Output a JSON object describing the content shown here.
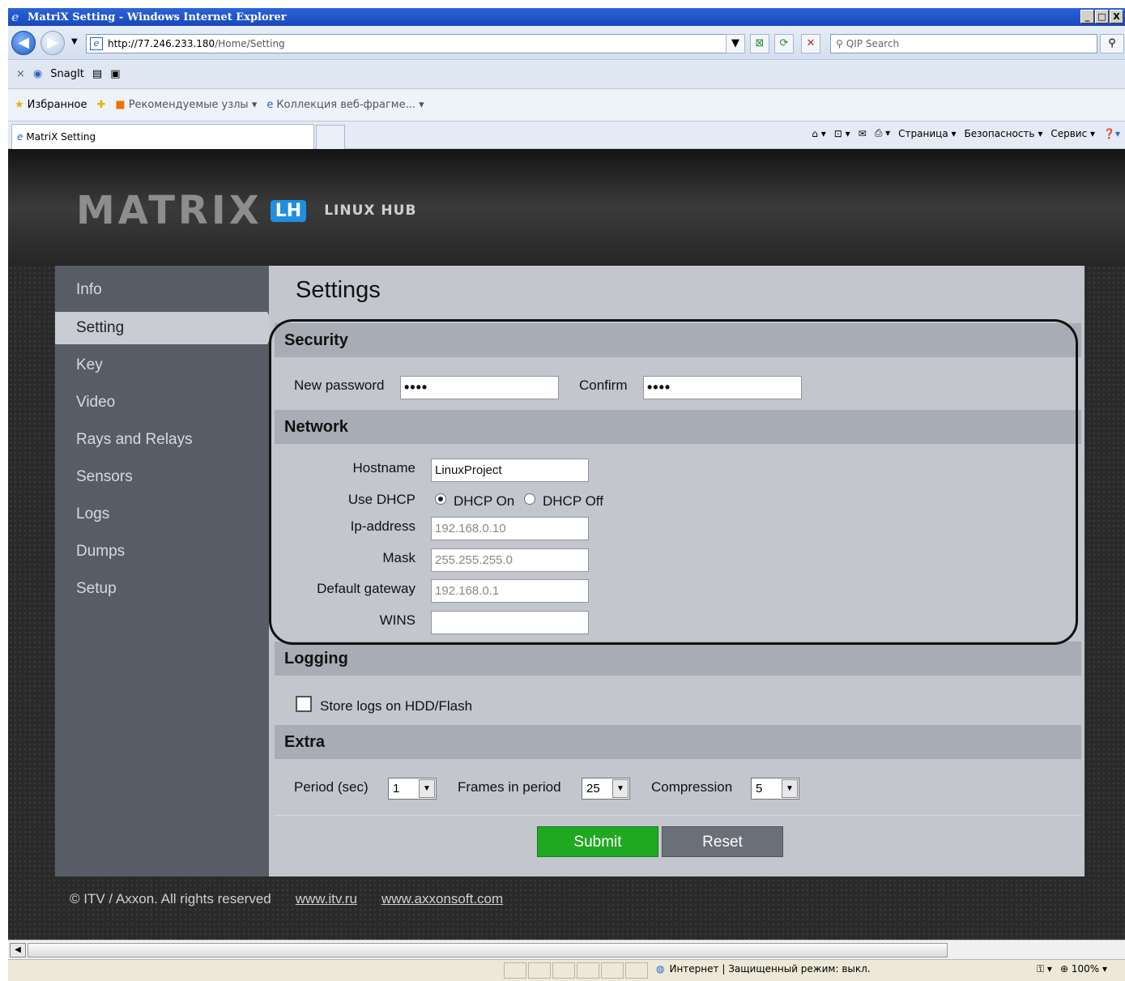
{
  "window": {
    "title": "MatriX Setting - Windows Internet Explorer",
    "minimize": "_",
    "maximize": "□",
    "close": "X"
  },
  "address_bar": {
    "url_host": "http://77.246.233.180",
    "url_path": "/Home/Setting",
    "search_placeholder": "QIP Search"
  },
  "toolbar": {
    "snagit_label": "SnagIt"
  },
  "favorites_bar": {
    "favorites_label": "Избранное",
    "suggested_sites": "Рекомендуемые узлы ▾",
    "web_slice_gallery": "Коллекция веб-фрагме... ▾"
  },
  "tab": {
    "title": "MatriX Setting"
  },
  "command_bar": {
    "page_menu": "Страница ▾",
    "safety_menu": "Безопасность ▾",
    "tools_menu": "Сервис ▾"
  },
  "brand": {
    "logo_text": "MATRIX",
    "logo_badge": "LH",
    "logo_subtitle": "LINUX HUB"
  },
  "sidebar": {
    "items": [
      {
        "label": "Info"
      },
      {
        "label": "Setting"
      },
      {
        "label": "Key"
      },
      {
        "label": "Video"
      },
      {
        "label": "Rays and Relays"
      },
      {
        "label": "Sensors"
      },
      {
        "label": "Logs"
      },
      {
        "label": "Dumps"
      },
      {
        "label": "Setup"
      }
    ],
    "active": "Setting"
  },
  "settings": {
    "title": "Settings",
    "security": {
      "header": "Security",
      "new_password_label": "New password",
      "new_password_value": "••••",
      "confirm_label": "Confirm",
      "confirm_value": "••••"
    },
    "network": {
      "header": "Network",
      "hostname_label": "Hostname",
      "hostname_value": "LinuxProject",
      "dhcp_label": "Use DHCP",
      "dhcp_on_label": "DHCP On",
      "dhcp_off_label": "DHCP Off",
      "dhcp_selected": "DHCP On",
      "ip_label": "Ip-address",
      "ip_value": "192.168.0.10",
      "mask_label": "Mask",
      "mask_value": "255.255.255.0",
      "gateway_label": "Default gateway",
      "gateway_value": "192.168.0.1",
      "wins_label": "WINS",
      "wins_value": ""
    },
    "logging": {
      "header": "Logging",
      "store_logs_label": "Store logs on HDD/Flash",
      "store_logs_checked": false
    },
    "extra": {
      "header": "Extra",
      "period_label": "Period (sec)",
      "period_value": "1",
      "frames_label": "Frames in period",
      "frames_value": "25",
      "compression_label": "Compression",
      "compression_value": "5"
    },
    "submit_label": "Submit",
    "reset_label": "Reset"
  },
  "footer": {
    "copyright": "© ITV / Axxon. All rights reserved",
    "link1": "www.itv.ru",
    "link2": "www.axxonsoft.com"
  },
  "status_bar": {
    "zone": "Интернет | Защищенный режим: выкл.",
    "zoom": "100%"
  },
  "colors": {
    "submit": "#21a821",
    "reset": "#6b6f78",
    "sidebar_bg": "#585c66",
    "content_bg": "#c3c6cd",
    "section_header": "#a8acb5",
    "logo_badge": "#1f8fe0"
  }
}
